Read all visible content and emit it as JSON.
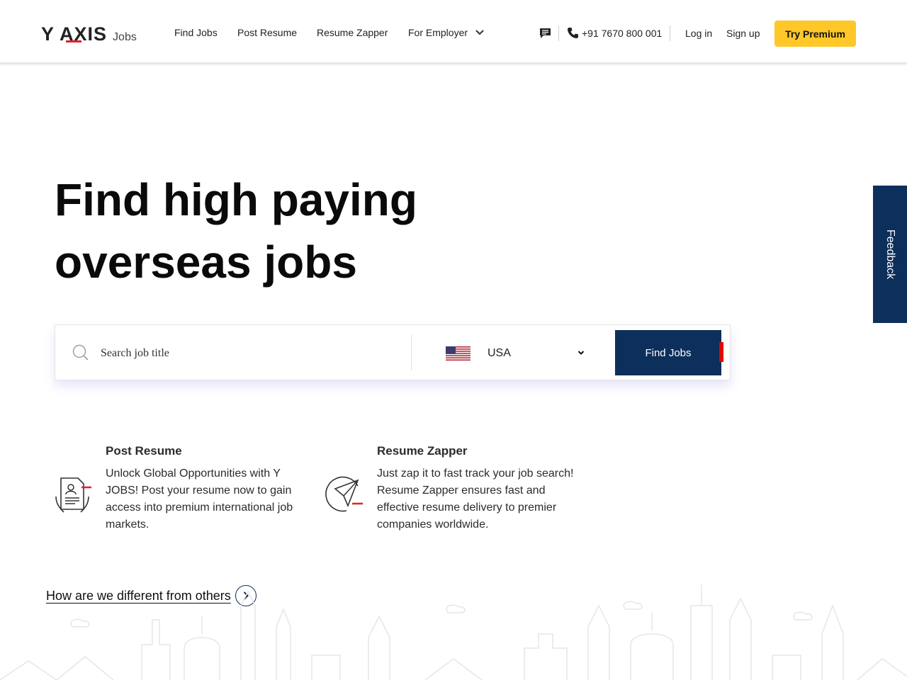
{
  "header": {
    "logo_main": "Y AXIS",
    "logo_sub": "Jobs",
    "nav": {
      "find_jobs": "Find Jobs",
      "post_resume": "Post Resume",
      "resume_zapper": "Resume Zapper",
      "for_employer": "For Employer"
    },
    "phone": "+91 7670 800 001",
    "login": "Log in",
    "signup": "Sign up",
    "premium": "Try Premium"
  },
  "hero": {
    "title_line1": "Find high paying",
    "title_line2": "overseas jobs"
  },
  "search": {
    "placeholder": "Search job title",
    "country": "USA",
    "button": "Find Jobs"
  },
  "feedback": "Feedback",
  "features": [
    {
      "title": "Post Resume",
      "desc": "Unlock Global Opportunities with Y JOBS! Post your resume now to gain access into premium international job markets."
    },
    {
      "title": "Resume Zapper",
      "desc": "Just zap it to fast track your job search! Resume Zapper ensures fast and effective resume delivery to premier companies worldwide."
    }
  ],
  "different_link": "How are we different from others",
  "colors": {
    "brand_navy": "#0d2f5b",
    "accent_red": "#e32227",
    "premium_yellow": "#ffc727"
  }
}
